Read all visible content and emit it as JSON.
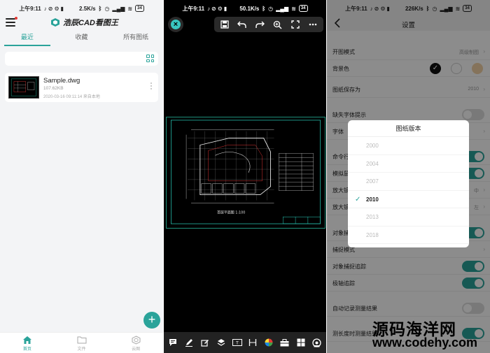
{
  "colors": {
    "accent": "#2aa39a",
    "cad_frame": "#1e8f7a",
    "viewer_bg": "#000000"
  },
  "status": {
    "time": "上午9:11",
    "left_speed": "2.5K/s",
    "mid_speed": "50.1K/s",
    "right_speed": "226K/s",
    "battery": "34"
  },
  "files_app": {
    "brand_name": "浩辰CAD看图王",
    "tabs": [
      {
        "label": "最近",
        "active": true
      },
      {
        "label": "收藏",
        "active": false
      },
      {
        "label": "所有图纸",
        "active": false
      }
    ],
    "recent_file": {
      "name": "Sample.dwg",
      "size": "107.62KB",
      "meta": "2020-03-16 09:11:14  来自本地"
    },
    "fab_symbol": "+",
    "bottom_nav": [
      {
        "label": "首页",
        "icon": "home-icon",
        "active": true
      },
      {
        "label": "文件",
        "icon": "folder-icon",
        "active": false
      },
      {
        "label": "云图",
        "icon": "cloud-hexagon-icon",
        "active": false
      }
    ]
  },
  "viewer": {
    "top_tools": [
      "save-icon",
      "undo-icon",
      "redo-icon",
      "zoom-icon",
      "fullscreen-icon",
      "more-icon"
    ],
    "bottom_tools": [
      "comment-icon",
      "pen-icon",
      "edit-icon",
      "layers-icon",
      "text-icon",
      "measure-icon",
      "color-icon",
      "toolbox-icon",
      "grid-icon",
      "settings-icon"
    ],
    "drawing_title": "首层平面图 1:100"
  },
  "settings": {
    "title": "设置",
    "rows": [
      {
        "label": "开图模式",
        "value": "高级制图",
        "type": "value"
      },
      {
        "label": "背景色",
        "type": "swatches"
      },
      {
        "label": "图纸保存为",
        "value": "2010",
        "type": "value"
      },
      {
        "label": "缺失字体提示",
        "type": "toggle",
        "on": false
      },
      {
        "label": "字体",
        "type": "chevron"
      },
      {
        "label": "命令行",
        "type": "toggle",
        "on": true
      },
      {
        "label": "模拟鼠标",
        "type": "toggle",
        "on": true
      },
      {
        "label": "放大镜",
        "value": "中",
        "type": "value"
      },
      {
        "label": "放大镜位置",
        "value": "左",
        "type": "value"
      },
      {
        "label": "对象捕捉",
        "type": "toggle",
        "on": true
      },
      {
        "label": "捕捉模式",
        "type": "chevron"
      },
      {
        "label": "对象捕捉追踪",
        "type": "toggle",
        "on": true
      },
      {
        "label": "极轴追踪",
        "type": "toggle",
        "on": true
      },
      {
        "label": "自动记录测量结果",
        "type": "toggle",
        "on": false
      },
      {
        "label": "测长度时测量结果",
        "type": "toggle",
        "on": true
      }
    ],
    "dialog": {
      "title": "图纸版本",
      "options": [
        "2000",
        "2004",
        "2007",
        "2010",
        "2013",
        "2018"
      ],
      "selected": "2010"
    }
  },
  "watermark": {
    "cn": "源码海洋网",
    "url": "www.codehy.com"
  }
}
